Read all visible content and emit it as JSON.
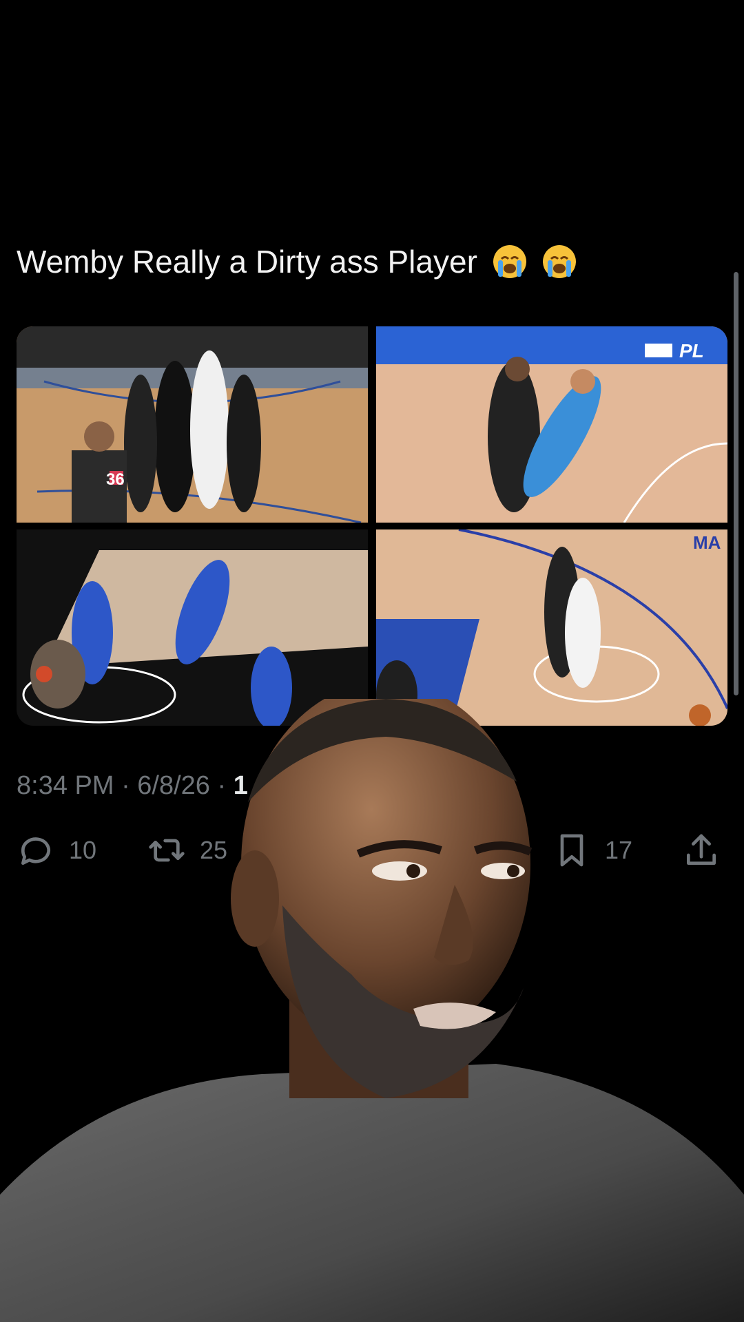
{
  "tweet": {
    "text": "Wemby Really a Dirty ass Player",
    "emojis": [
      "loudly-crying-face",
      "loudly-crying-face"
    ],
    "timestamp": "8:34 PM · 6/8/26 · ",
    "views_partial": "1"
  },
  "media": {
    "images": [
      {
        "name": "spurs-players-huddle-referee-36"
      },
      {
        "name": "spurs-player-shoves-thunder-player"
      },
      {
        "name": "knicks-players-fall-on-court"
      },
      {
        "name": "spurs-player-tangles-knicks-player"
      }
    ],
    "partial_court_text": "PL",
    "partial_court_text_2": "MA",
    "referee_number": "36"
  },
  "actions": {
    "replies": "10",
    "retweets": "25",
    "bookmarks": "17"
  },
  "icons": {
    "reply": "reply-icon",
    "retweet": "retweet-icon",
    "bookmark": "bookmark-icon",
    "share": "share-icon"
  },
  "overlay": {
    "description_icon": "person-reaction-overlay"
  },
  "colors": {
    "background": "#000000",
    "text": "#e7e9ea",
    "muted": "#71767b"
  }
}
